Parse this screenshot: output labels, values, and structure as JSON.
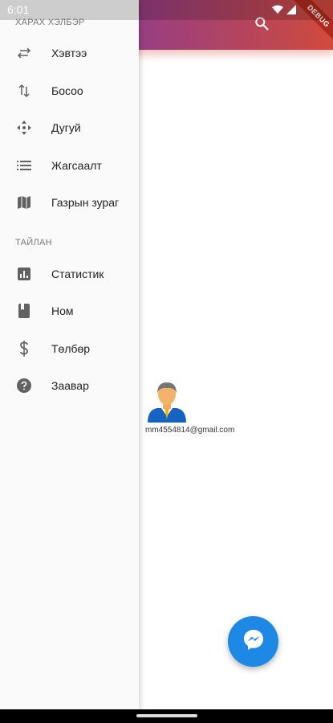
{
  "status_bar": {
    "time": "6:01"
  },
  "app_bar": {
    "debug_banner": "DEBUG"
  },
  "drawer": {
    "view_section_header": "ХАРАХ ХЭЛБЭР",
    "view_items": [
      {
        "label": "Хэвтээ",
        "icon": "swap-horiz-icon"
      },
      {
        "label": "Босоо",
        "icon": "swap-vert-icon"
      },
      {
        "label": "Дугуй",
        "icon": "move-arrows-icon"
      },
      {
        "label": "Жагсаалт",
        "icon": "list-icon"
      },
      {
        "label": "Газрын зураг",
        "icon": "map-icon"
      }
    ],
    "report_section_header": "ТАЙЛАН",
    "report_items": [
      {
        "label": "Статистик",
        "icon": "bar-chart-icon"
      },
      {
        "label": "Ном",
        "icon": "book-icon"
      },
      {
        "label": "Төлбөр",
        "icon": "dollar-icon"
      },
      {
        "label": "Заавар",
        "icon": "help-icon"
      }
    ]
  },
  "contact": {
    "email": "mm4554814@gmail.com"
  },
  "colors": {
    "appbar_start": "#6a3d86",
    "appbar_end": "#d24a3c",
    "fab": "#1e88e5",
    "drawer_bg": "#fafafa",
    "icon_gray": "#616161"
  }
}
